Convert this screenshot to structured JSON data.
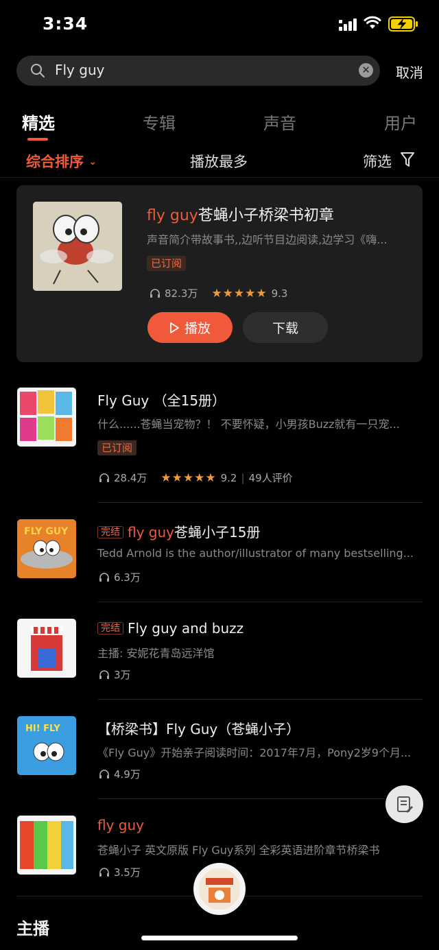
{
  "status": {
    "time": "3:34"
  },
  "search": {
    "query": "Fly guy",
    "cancel_label": "取消"
  },
  "tabs": [
    {
      "label": "精选"
    },
    {
      "label": "专辑"
    },
    {
      "label": "声音"
    },
    {
      "label": "用户"
    }
  ],
  "sort": {
    "comprehensive": "综合排序",
    "most_played": "播放最多",
    "filter": "筛选"
  },
  "featured": {
    "title_highlight": "fly guy",
    "title_rest": "苍蝇小子桥梁书初章",
    "desc": "声音简介带故事书,,边听节目边阅读,边学习《嗨...",
    "tag": "已订阅",
    "plays": "82.3万",
    "stars": "★★★★★",
    "rating": "9.3",
    "play_label": "播放",
    "download_label": "下载"
  },
  "list": [
    {
      "title": "Fly Guy （全15册）",
      "desc": "什么......苍蝇当宠物？！ 不要怀疑，小男孩Buzz就有一只宠...",
      "tag": "已订阅",
      "plays": "28.4万",
      "stars": "★★★★★",
      "rating": "9.2",
      "reviews": "49人评价"
    },
    {
      "done_tag": "完结",
      "title_highlight": "fly guy",
      "title_rest": "苍蝇小子15册",
      "desc": "Tedd Arnold is the author/illustrator of many bestselling...",
      "plays": "6.3万"
    },
    {
      "done_tag": "完结",
      "title": "Fly guy and buzz",
      "desc": "主播: 安妮花青岛远洋馆",
      "plays": "3万"
    },
    {
      "title": "【桥梁书】Fly Guy（苍蝇小子）",
      "desc": "《Fly Guy》开始亲子阅读时间：2017年7月，Pony2岁9个月...",
      "plays": "4.9万"
    },
    {
      "title_highlight": "fly guy",
      "desc": "苍蝇小子 英文原版 Fly Guy系列 全彩英语进阶章节桥梁书",
      "plays": "3.5万"
    }
  ],
  "section": {
    "anchors": "主播"
  },
  "colors": {
    "accent": "#f05a3a",
    "card_bg": "#1e1e1e",
    "page_bg": "#000000"
  }
}
